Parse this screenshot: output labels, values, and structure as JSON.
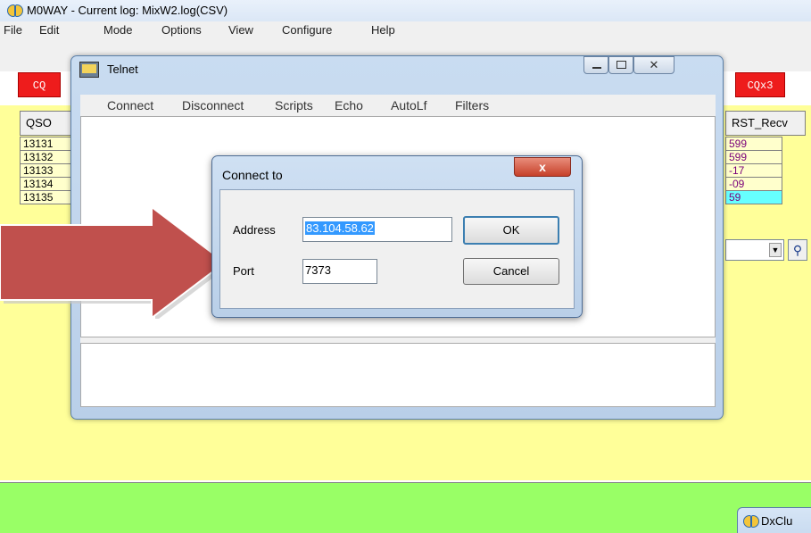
{
  "main_window": {
    "title": "M0WAY - Current log: MixW2.log(CSV)",
    "menu": [
      "File",
      "Edit",
      "Mode",
      "Options",
      "View",
      "Configure",
      "Help"
    ]
  },
  "toolbar": {
    "cq_label": "CQ",
    "cqx3_label": "CQx3"
  },
  "grid": {
    "left_header": "QSO",
    "left_rows": [
      "13131",
      "13132",
      "13133",
      "13134",
      "13135"
    ],
    "right_header": "RST_Recv",
    "right_rows": [
      "599",
      "599",
      "-17",
      "-09",
      "59"
    ]
  },
  "telnet": {
    "title": "Telnet",
    "menu": [
      "Connect",
      "Disconnect",
      "Scripts",
      "Echo",
      "AutoLf",
      "Filters"
    ]
  },
  "dialog": {
    "title": "Connect to",
    "close_label": "x",
    "address_label": "Address",
    "address_value": "83.104.58.62",
    "port_label": "Port",
    "port_value": "7373",
    "ok_label": "OK",
    "cancel_label": "Cancel"
  },
  "dxcluster": {
    "title": "DxClu"
  },
  "colors": {
    "grid_background": "#ffff99",
    "status_green": "#99ff66",
    "toolbar_red": "#ee1c1c",
    "arrow_red": "#c0504d",
    "selection_blue": "#3399ff"
  }
}
